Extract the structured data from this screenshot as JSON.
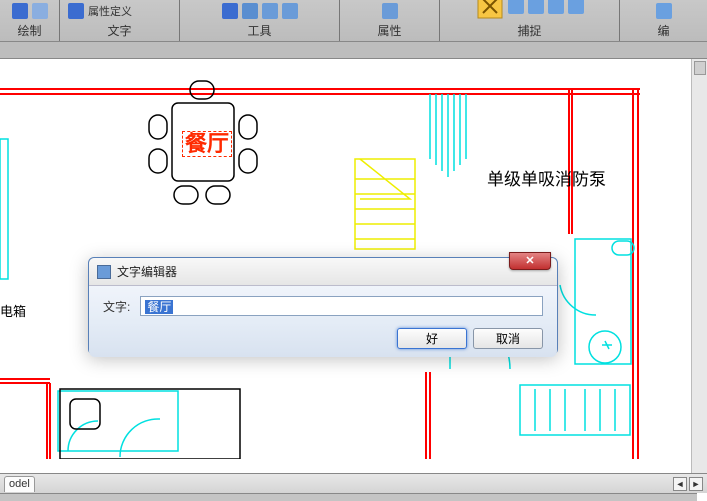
{
  "ribbon": {
    "groups": [
      {
        "label": "绘制"
      },
      {
        "label": "文字",
        "sub": "属性定义"
      },
      {
        "label": "工具"
      },
      {
        "label": "属性"
      },
      {
        "label": "捕捉"
      },
      {
        "label": "编"
      }
    ]
  },
  "dialog": {
    "title": "文字编辑器",
    "field_label": "文字:",
    "value": "餐厅",
    "ok": "好",
    "cancel": "取消"
  },
  "canvas": {
    "label_dining": "餐厅",
    "label_pump": "单级单吸消防泵",
    "label_box_tail": "电箱"
  },
  "status": {
    "tab": "odel"
  }
}
